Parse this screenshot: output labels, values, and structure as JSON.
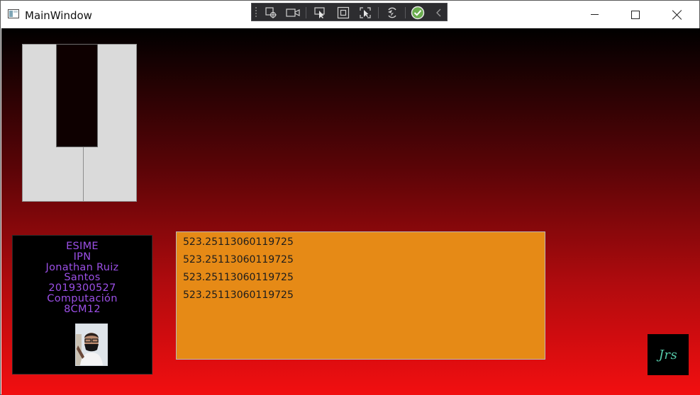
{
  "window": {
    "title": "MainWindow"
  },
  "dev_toolbar": {
    "tools": [
      "select-element-icon",
      "video-icon",
      "cursor-select-icon",
      "bounds-icon",
      "track-focus-icon",
      "hot-reload-icon",
      "check-icon",
      "collapse-icon"
    ],
    "accent": "#78c55a"
  },
  "id_card": {
    "lines": [
      "ESIME",
      "IPN",
      "Jonathan Ruiz",
      "Santos",
      "2019300527",
      "Computación",
      "8CM12"
    ],
    "text_color": "#9b4fe6"
  },
  "output": {
    "lines": [
      "523.25113060119725",
      "523.25113060119725",
      "523.25113060119725",
      "523.25113060119725"
    ],
    "background": "#e68a16"
  },
  "logo": {
    "text": "Jrs",
    "color": "#55c8a8"
  },
  "colors": {
    "gradient_top": "#000000",
    "gradient_bottom": "#f20e10",
    "panel_light": "#dadada",
    "panel_dark": "#0e0000"
  }
}
